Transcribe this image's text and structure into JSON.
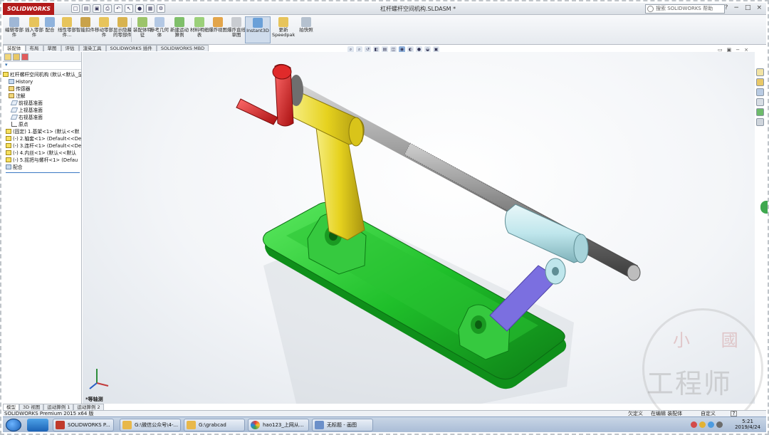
{
  "titlebar": {
    "logo": "SOLIDWORKS",
    "document": "杠杆螺杆空间机构.SLDASM *",
    "help_search_placeholder": "搜索 SOLIDWORKS 帮助",
    "controls": [
      "?",
      "−",
      "□",
      "×"
    ]
  },
  "ribbon": {
    "buttons": [
      {
        "label": "编辑零部件",
        "icon": "edit-component-icon"
      },
      {
        "label": "插入零部件",
        "icon": "insert-component-icon"
      },
      {
        "label": "配合",
        "icon": "mate-icon"
      },
      {
        "label": "线性零部件...",
        "icon": "linear-pattern-icon"
      },
      {
        "label": "智能扣件",
        "icon": "smart-fasteners-icon"
      },
      {
        "label": "移动零部件",
        "icon": "move-component-icon"
      },
      {
        "label": "显示隐藏的零部件",
        "icon": "show-hidden-icon"
      },
      {
        "label": "装配体特征",
        "icon": "assembly-features-icon"
      },
      {
        "label": "参考几何体",
        "icon": "reference-geometry-icon"
      },
      {
        "label": "新建运动算例",
        "icon": "motion-study-icon"
      },
      {
        "label": "材料明细表",
        "icon": "bom-icon"
      },
      {
        "label": "爆炸视图",
        "icon": "exploded-view-icon"
      },
      {
        "label": "爆炸直线草图",
        "icon": "explode-line-sketch-icon"
      },
      {
        "label": "Instant3D",
        "icon": "instant3d-icon"
      },
      {
        "label": "更新Speedpak",
        "icon": "speedpak-icon"
      },
      {
        "label": "拍快照",
        "icon": "snapshot-icon"
      }
    ]
  },
  "command_tabs": [
    "装配体",
    "布局",
    "草图",
    "评估",
    "渲染工具",
    "SOLIDWORKS 插件",
    "SOLIDWORKS MBD"
  ],
  "feature_tree": {
    "root": "杠杆螺杆空间机构 (默认<默认_显",
    "items": [
      {
        "label": "History",
        "icon": "history-icon"
      },
      {
        "label": "传感器",
        "icon": "sensors-icon"
      },
      {
        "label": "注解",
        "icon": "annotations-icon"
      },
      {
        "label": "前视基准面",
        "icon": "plane-icon"
      },
      {
        "label": "上视基准面",
        "icon": "plane-icon"
      },
      {
        "label": "右视基准面",
        "icon": "plane-icon"
      },
      {
        "label": "原点",
        "icon": "origin-icon"
      },
      {
        "label": "(固定) 1.基架<1> (默认<<默",
        "icon": "part-icon"
      },
      {
        "label": "(-) 2.轴套<1> (Default<<De",
        "icon": "part-icon"
      },
      {
        "label": "(-) 3.连杆<1> (Default<<De",
        "icon": "part-icon"
      },
      {
        "label": "(-) 4.内丝<1> (默认<<默认",
        "icon": "part-icon"
      },
      {
        "label": "(-) 5.摇把与螺杆<1> (Defau",
        "icon": "part-icon"
      },
      {
        "label": "配合",
        "icon": "mates-icon"
      }
    ]
  },
  "bottom_tabs": [
    "模型",
    "3D 视图",
    "运动算例 1",
    "运动算例 2"
  ],
  "view": {
    "label": "*等轴测"
  },
  "statusbar": {
    "product": "SOLIDWORKS Premium 2015 x64 版",
    "definition": "欠定义",
    "editing": "在编辑 装配体",
    "custom": "自定义",
    "help": "?"
  },
  "taskbar": {
    "items": [
      {
        "label": "SOLIDWORKS P...",
        "color": "#c0392b"
      },
      {
        "label": "G:\\微信公众号\\4-...",
        "color": "#e8b84a"
      },
      {
        "label": "G:\\grabcad",
        "color": "#e8b84a"
      },
      {
        "label": "hao123_上网从...",
        "color": "#3b82f6"
      },
      {
        "label": "无标题 - 画图",
        "color": "#6b8fc9"
      }
    ],
    "time": "5:21",
    "date": "2019/4/24"
  },
  "watermark": {
    "line1": "小 國",
    "line2": "工程师"
  },
  "colors": {
    "base": "#1fbf2a",
    "link_yellow": "#e6d21e",
    "link_blue": "#7b6fe0",
    "sleeve_cyan": "#bfe6ec",
    "crank_red": "#d91f1f",
    "shaft_gray": "#8d8d8d"
  }
}
